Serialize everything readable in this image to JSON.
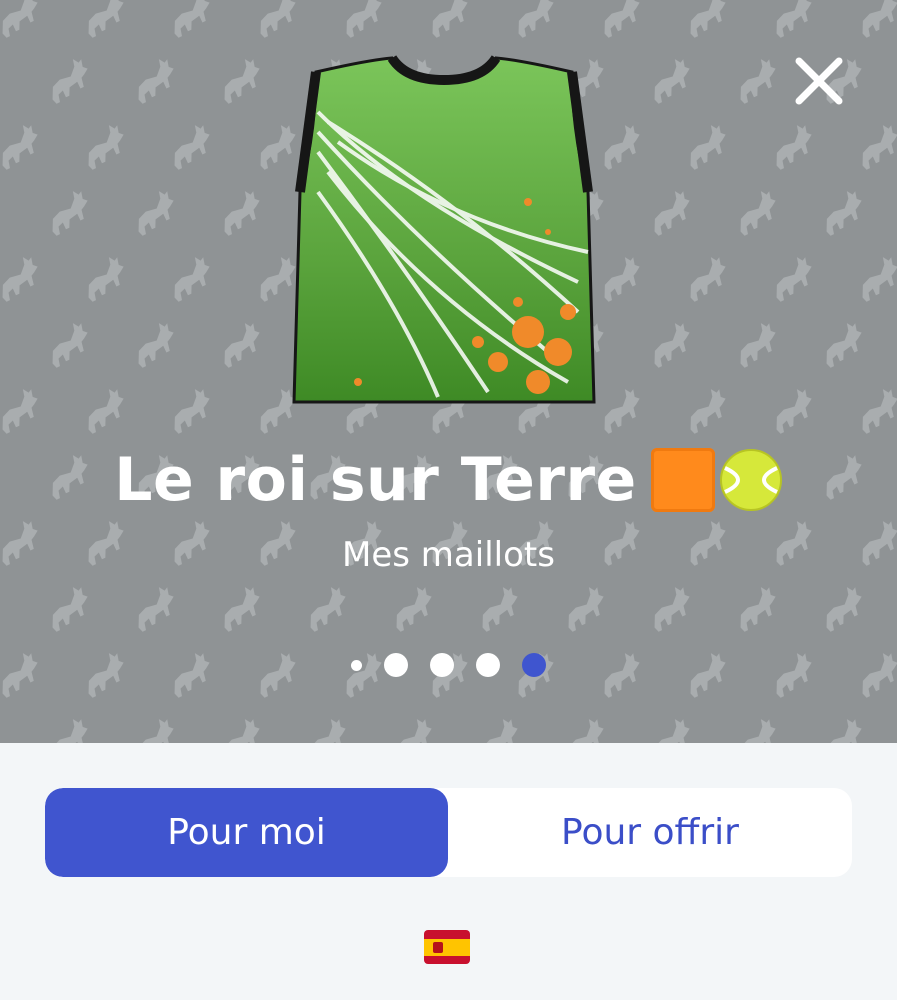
{
  "header": {
    "close_icon": "close-icon",
    "title": "Le roi sur Terre",
    "title_emojis": [
      "orange-square-emoji",
      "tennis-ball-emoji"
    ],
    "subtitle": "Mes maillots"
  },
  "product": {
    "image_name": "green-jersey",
    "colors": {
      "jersey": "#5aa33c",
      "accent": "#f08a2a",
      "background": "#8f9395"
    }
  },
  "carousel": {
    "page_count": 5,
    "current_index": 4,
    "active_color": "#3f55cf"
  },
  "segmented_control": {
    "options": [
      "Pour moi",
      "Pour offrir"
    ],
    "selected": "Pour moi",
    "accent": "#4055cf"
  },
  "footer": {
    "flag": "spain-flag-icon"
  }
}
